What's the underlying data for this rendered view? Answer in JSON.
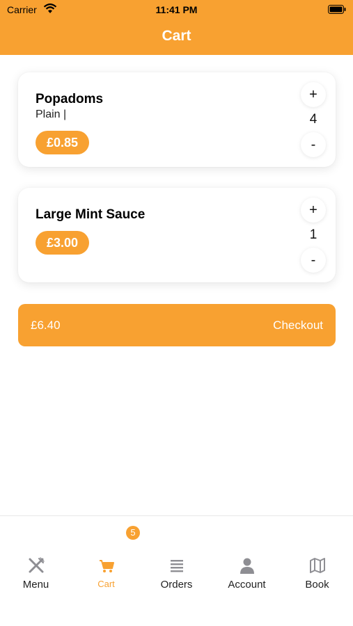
{
  "status_bar": {
    "carrier": "Carrier",
    "time": "11:41 PM"
  },
  "header": {
    "title": "Cart"
  },
  "cart": {
    "items": [
      {
        "name": "Popadoms",
        "option": "Plain |",
        "price": "£0.85",
        "quantity": "4",
        "plus": "+",
        "minus": "-"
      },
      {
        "name": "Large Mint Sauce",
        "price": "£3.00",
        "quantity": "1",
        "plus": "+",
        "minus": "-"
      }
    ],
    "total": "£6.40",
    "checkout_label": "Checkout"
  },
  "tabbar": {
    "cart_badge": "5",
    "tabs": [
      {
        "label": "Menu",
        "icon": "utensils-icon"
      },
      {
        "label": "Cart",
        "icon": "cart-icon"
      },
      {
        "label": "Orders",
        "icon": "list-icon"
      },
      {
        "label": "Account",
        "icon": "person-icon"
      },
      {
        "label": "Book",
        "icon": "map-icon"
      }
    ]
  },
  "colors": {
    "accent": "#F8A131",
    "icon_gray": "#8E8E93"
  }
}
